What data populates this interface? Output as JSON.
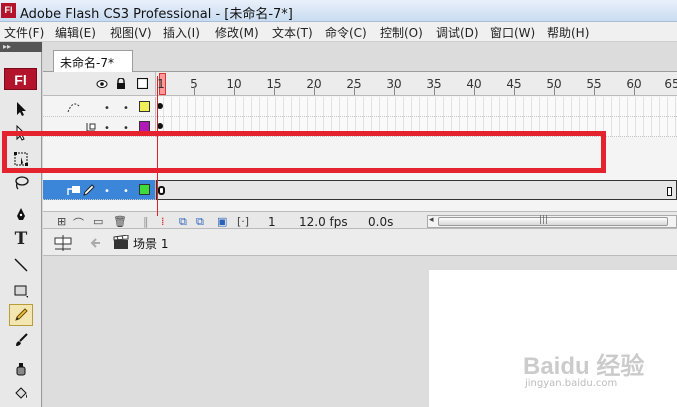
{
  "window": {
    "title": "Adobe Flash CS3 Professional - [未命名-7*]",
    "app_icon_text": "Fl"
  },
  "menu": [
    "文件(F)",
    "编辑(E)",
    "视图(V)",
    "插入(I)",
    "修改(M)",
    "文本(T)",
    "命令(C)",
    "控制(O)",
    "调试(D)",
    "窗口(W)",
    "帮助(H)"
  ],
  "toolbar": {
    "header": "▸▸",
    "logo": "Fl",
    "tools": [
      {
        "name": "selection-tool",
        "icon": "arrow"
      },
      {
        "name": "subselection-tool",
        "icon": "hollow-arrow"
      },
      {
        "name": "free-transform-tool",
        "icon": "transform"
      },
      {
        "name": "lasso-tool",
        "icon": "lasso"
      },
      {
        "name": "pen-tool",
        "icon": "pen"
      },
      {
        "name": "text-tool",
        "icon": "T"
      },
      {
        "name": "line-tool",
        "icon": "line"
      },
      {
        "name": "rectangle-tool",
        "icon": "rect"
      },
      {
        "name": "pencil-tool",
        "icon": "pencil",
        "active": true
      },
      {
        "name": "brush-tool",
        "icon": "brush"
      },
      {
        "name": "ink-bottle-tool",
        "icon": "ink"
      },
      {
        "name": "paint-bucket-tool",
        "icon": "bucket"
      }
    ]
  },
  "document_tab": "未命名-7*",
  "timeline": {
    "ruler_labels": [
      "1",
      "5",
      "10",
      "15",
      "20",
      "25",
      "30",
      "35",
      "40",
      "45",
      "50",
      "55",
      "60",
      "65"
    ],
    "header_icons": [
      "eye-icon",
      "lock-icon",
      "outline-icon"
    ],
    "layers": [
      {
        "kind": "motion-guide",
        "swatch": "#f2f05a",
        "selected": false
      },
      {
        "kind": "normal",
        "swatch": "#b21ab8",
        "selected": false
      },
      {
        "kind": "normal",
        "swatch": "#3ddc3a",
        "selected": true
      }
    ],
    "status": {
      "current_frame": "1",
      "frame_rate": "12.0 fps",
      "elapsed": "0.0s"
    }
  },
  "scene": {
    "label": "场景 1"
  },
  "watermark": {
    "text": "Baidu 经验",
    "sub": "jingyan.baidu.com"
  },
  "colors": {
    "highlight_box": "#e4232f",
    "selected_layer": "#3b86d8",
    "playhead": "#d22222"
  }
}
